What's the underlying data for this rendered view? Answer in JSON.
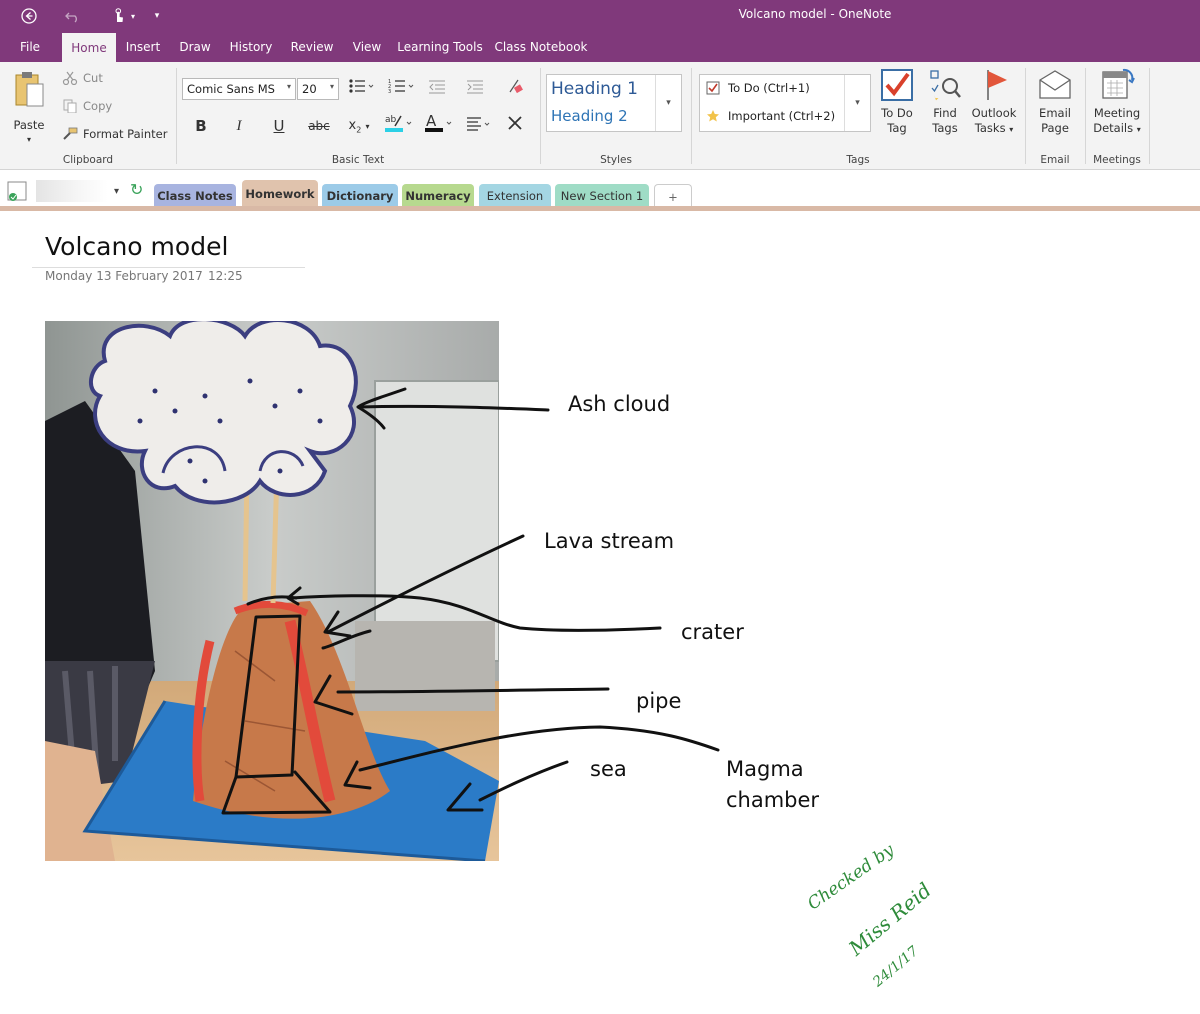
{
  "app": {
    "window_title": "Volcano model  -  OneNote"
  },
  "ribbon_tabs": [
    "File",
    "Home",
    "Insert",
    "Draw",
    "History",
    "Review",
    "View",
    "Learning Tools",
    "Class Notebook"
  ],
  "active_tab": "Home",
  "clipboard": {
    "paste": "Paste",
    "cut": "Cut",
    "copy": "Copy",
    "format_painter": "Format Painter",
    "group": "Clipboard"
  },
  "basic_text": {
    "font": "Comic Sans MS",
    "size": "20",
    "group": "Basic Text"
  },
  "styles": {
    "heading1": "Heading 1",
    "heading2": "Heading 2",
    "group": "Styles"
  },
  "tags": {
    "todo": "To Do (Ctrl+1)",
    "important": "Important (Ctrl+2)",
    "todo_tag_line1": "To Do",
    "todo_tag_line2": "Tag",
    "find_tags_line1": "Find",
    "find_tags_line2": "Tags",
    "outlook_line1": "Outlook",
    "outlook_line2": "Tasks",
    "group": "Tags"
  },
  "email": {
    "line1": "Email",
    "line2": "Page",
    "group": "Email"
  },
  "meetings": {
    "line1": "Meeting",
    "line2": "Details",
    "group": "Meetings"
  },
  "sections": [
    {
      "label": "Class Notes",
      "color": "#a8b4e0"
    },
    {
      "label": "Homework",
      "color": "#e0c3ad"
    },
    {
      "label": "Dictionary",
      "color": "#9ccbe8"
    },
    {
      "label": "Numeracy",
      "color": "#b7d98f"
    },
    {
      "label": "Extension",
      "color": "#a4d6e3"
    },
    {
      "label": "New Section 1",
      "color": "#9fdcc6"
    },
    {
      "label": "+",
      "color": "#ffffff"
    }
  ],
  "active_section": "Homework",
  "page": {
    "title": "Volcano model",
    "date": "Monday 13 February 2017",
    "time": "12:25"
  },
  "diagram_labels": {
    "ash_cloud": "Ash cloud",
    "lava_stream": "Lava stream",
    "crater": "crater",
    "pipe": "pipe",
    "sea": "sea",
    "magma_line1": "Magma",
    "magma_line2": "chamber"
  },
  "teacher_note": {
    "line1": "Checked by",
    "line2": "Miss Reid",
    "line3": "24/1/17",
    "color": "#2e8b3a"
  },
  "colors": {
    "brand": "#80397b",
    "ribbon_bg": "#f3f3f3"
  }
}
